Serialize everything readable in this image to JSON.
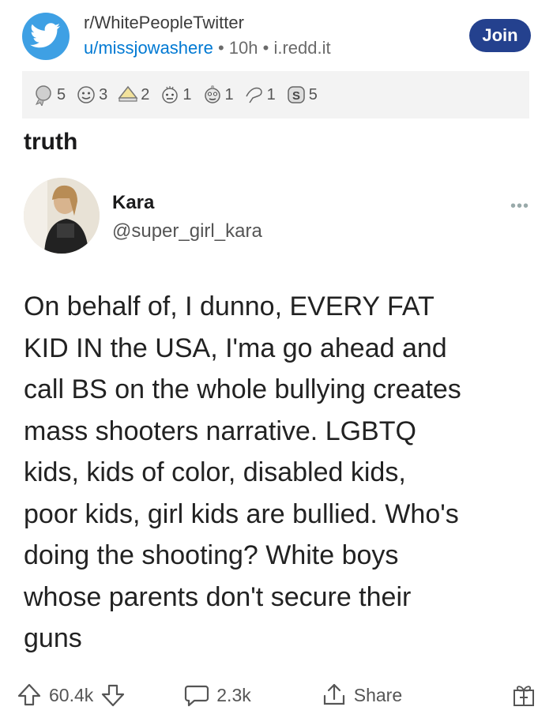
{
  "post": {
    "subreddit": "r/WhitePeopleTwitter",
    "user": "u/missjowashere",
    "sep1": "•",
    "time": "10h",
    "sep2": "•",
    "domain": "i.redd.it",
    "join_label": "Join",
    "title": "truth"
  },
  "awards": [
    {
      "icon": "award-silver-icon",
      "count": "5"
    },
    {
      "icon": "award-face-icon",
      "count": "3"
    },
    {
      "icon": "award-hat-icon",
      "count": "2"
    },
    {
      "icon": "award-face2-icon",
      "count": "1"
    },
    {
      "icon": "award-face3-icon",
      "count": "1"
    },
    {
      "icon": "award-hand-icon",
      "count": "1"
    },
    {
      "icon": "award-gold-icon",
      "count": "5"
    }
  ],
  "tweet": {
    "name": "Kara",
    "handle": "@super_girl_kara",
    "more": "•••",
    "text": "On behalf of, I dunno, EVERY FAT\nKID IN the USA, I'ma go ahead and\ncall BS on the whole bullying creates\nmass shooters narrative. LGBTQ\nkids, kids of color, disabled kids,\npoor kids, girl kids are bullied. Who's\ndoing the shooting? White boys\nwhose parents don't secure their\nguns"
  },
  "actions": {
    "upvotes": "60.4k",
    "comments": "2.3k",
    "share_label": "Share"
  },
  "colors": {
    "accent": "#0079d3",
    "join_button": "#24418e",
    "twitter_blue": "#3ea0e4"
  }
}
